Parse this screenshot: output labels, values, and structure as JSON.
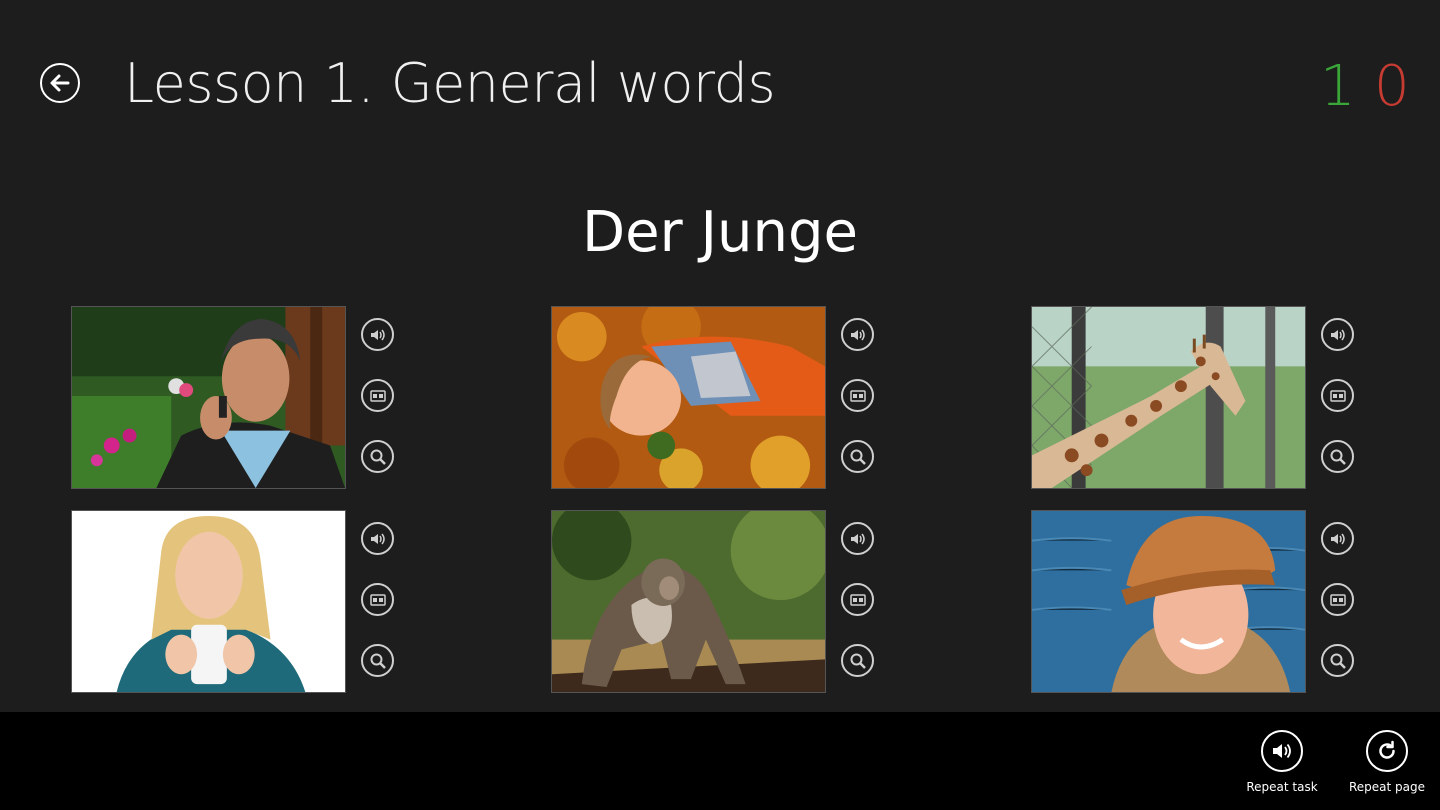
{
  "header": {
    "title": "Lesson 1. General words",
    "score_correct": "1",
    "score_wrong": "0",
    "score_correct_color": "#3aa63a",
    "score_wrong_color": "#c63b32"
  },
  "task": {
    "word": "Der Junge"
  },
  "cards": [
    {
      "photo": "man-on-phone-photo"
    },
    {
      "photo": "boy-in-leaves-photo"
    },
    {
      "photo": "giraffe-photo"
    },
    {
      "photo": "woman-with-cup-photo"
    },
    {
      "photo": "monkey-photo"
    },
    {
      "photo": "girl-in-hat-photo"
    }
  ],
  "card_actions": [
    "speaker-icon",
    "card-icon",
    "magnifier-icon"
  ],
  "appbar": {
    "repeat_task": "Repeat task",
    "repeat_page": "Repeat page"
  }
}
